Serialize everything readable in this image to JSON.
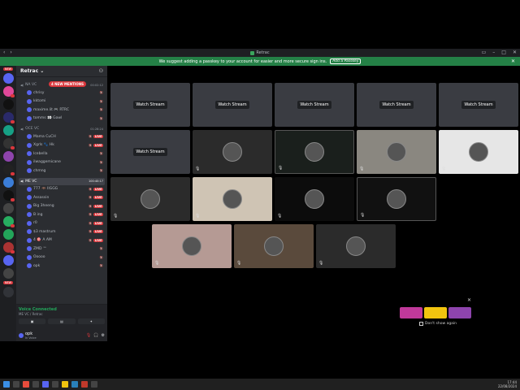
{
  "window": {
    "title": "Retrac"
  },
  "banner": {
    "text": "We suggest adding a passkey to your account for easier and more secure sign ins.",
    "button": "Add a Passkey"
  },
  "servers": {
    "new_badge": "NEW"
  },
  "guild": {
    "name": "Retrac",
    "mentions_badge": "4 NEW MENTIONS"
  },
  "voice_channels": [
    {
      "name": "NA VC",
      "time": "00:02:12",
      "active": false,
      "users": [
        {
          "name": "chrisy",
          "live": false
        },
        {
          "name": "kktomi",
          "live": false
        },
        {
          "name": "maxime.lit 🎮 RTRC",
          "live": false
        },
        {
          "name": "tomms 👀 Gawl",
          "live": false
        }
      ]
    },
    {
      "name": "OCE VC",
      "time": "01:28:24",
      "active": false,
      "users": [
        {
          "name": "Mama CuCH",
          "live": true
        },
        {
          "name": "Xgrls 🐾 Hk",
          "live": true
        },
        {
          "name": "Icebella",
          "live": false
        },
        {
          "name": "ilwaggemicane",
          "live": false
        },
        {
          "name": "chmng",
          "live": false
        }
      ]
    },
    {
      "name": "ME VC",
      "time": "100:40:17",
      "active": true,
      "users": [
        {
          "name": "777 🦇 IIGGG",
          "live": true
        },
        {
          "name": "Assassin",
          "live": true
        },
        {
          "name": "Big 3heeng",
          "live": true
        },
        {
          "name": "B ing",
          "live": true
        },
        {
          "name": "r0",
          "live": true
        },
        {
          "name": "$3 mastrum",
          "live": true
        },
        {
          "name": "4 🎯 A AM",
          "live": true
        },
        {
          "name": "ZMD ™",
          "live": false
        },
        {
          "name": "Ooooo",
          "live": false
        },
        {
          "name": "opk",
          "live": false
        }
      ]
    }
  ],
  "voice_status": {
    "connected": "Voice Connected",
    "channel": "ME VC / Retrac"
  },
  "user_panel": {
    "name": "opk",
    "status": "In Voice"
  },
  "stage": {
    "watch_label": "Watch Stream"
  },
  "popup": {
    "dont_show": "Don't show again"
  },
  "taskbar": {
    "time": "17:44",
    "date": "22/08/2024"
  },
  "colors": {
    "accent": "#248046",
    "live": "#da373c",
    "blurple": "#5865f2"
  }
}
